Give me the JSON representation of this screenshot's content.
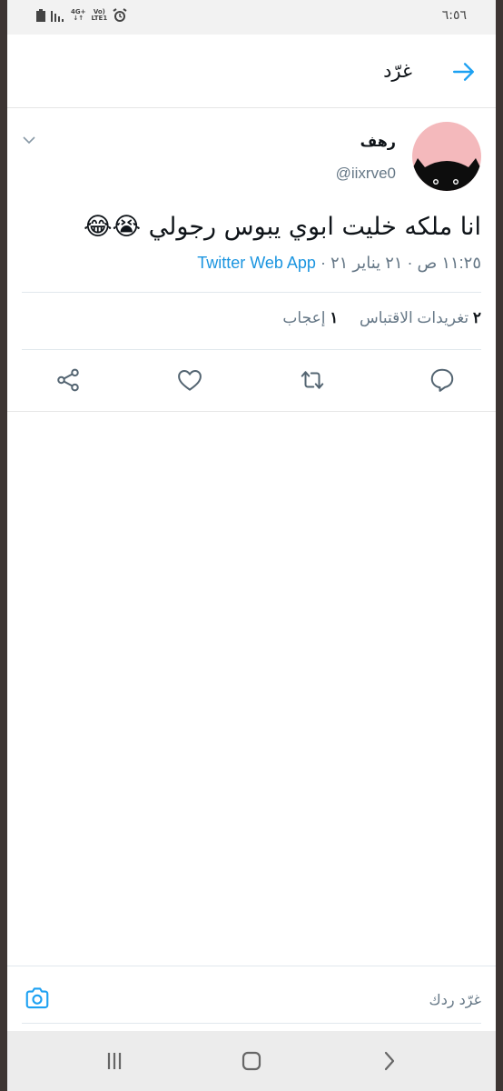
{
  "status_bar": {
    "time": "٦:٥٦",
    "network_top": "4G+",
    "network_bottom": "LTE1",
    "volte": "Vo)",
    "icons": [
      "battery-icon",
      "signal-icon",
      "volte-icon",
      "alarm-icon"
    ]
  },
  "header": {
    "title": "غرّد",
    "back_icon": "arrow-right-icon"
  },
  "tweet": {
    "display_name": "رهف",
    "handle": "@iixrve0",
    "text": "انا  ملكه خليت ابوي يبوس رجولي 😭😂",
    "time": "١١:٢٥ ص",
    "date": "٢١ يناير ٢١",
    "separator": "·",
    "source": "Twitter Web App",
    "retweets_count": "٢",
    "retweets_label": "تغريدات الاقتباس",
    "likes_count": "١",
    "likes_label": "إعجاب",
    "avatar_bg": "#f4b9bc"
  },
  "actions": [
    "reply-icon",
    "retweet-icon",
    "like-icon",
    "share-icon"
  ],
  "reply_bar": {
    "placeholder": "غرّد ردك",
    "camera_icon": "camera-icon"
  },
  "nav_bar": [
    "recents-icon",
    "home-icon",
    "back-icon"
  ],
  "colors": {
    "accent": "#1da1f2",
    "link": "#1b95e0",
    "secondary_text": "#657786"
  }
}
